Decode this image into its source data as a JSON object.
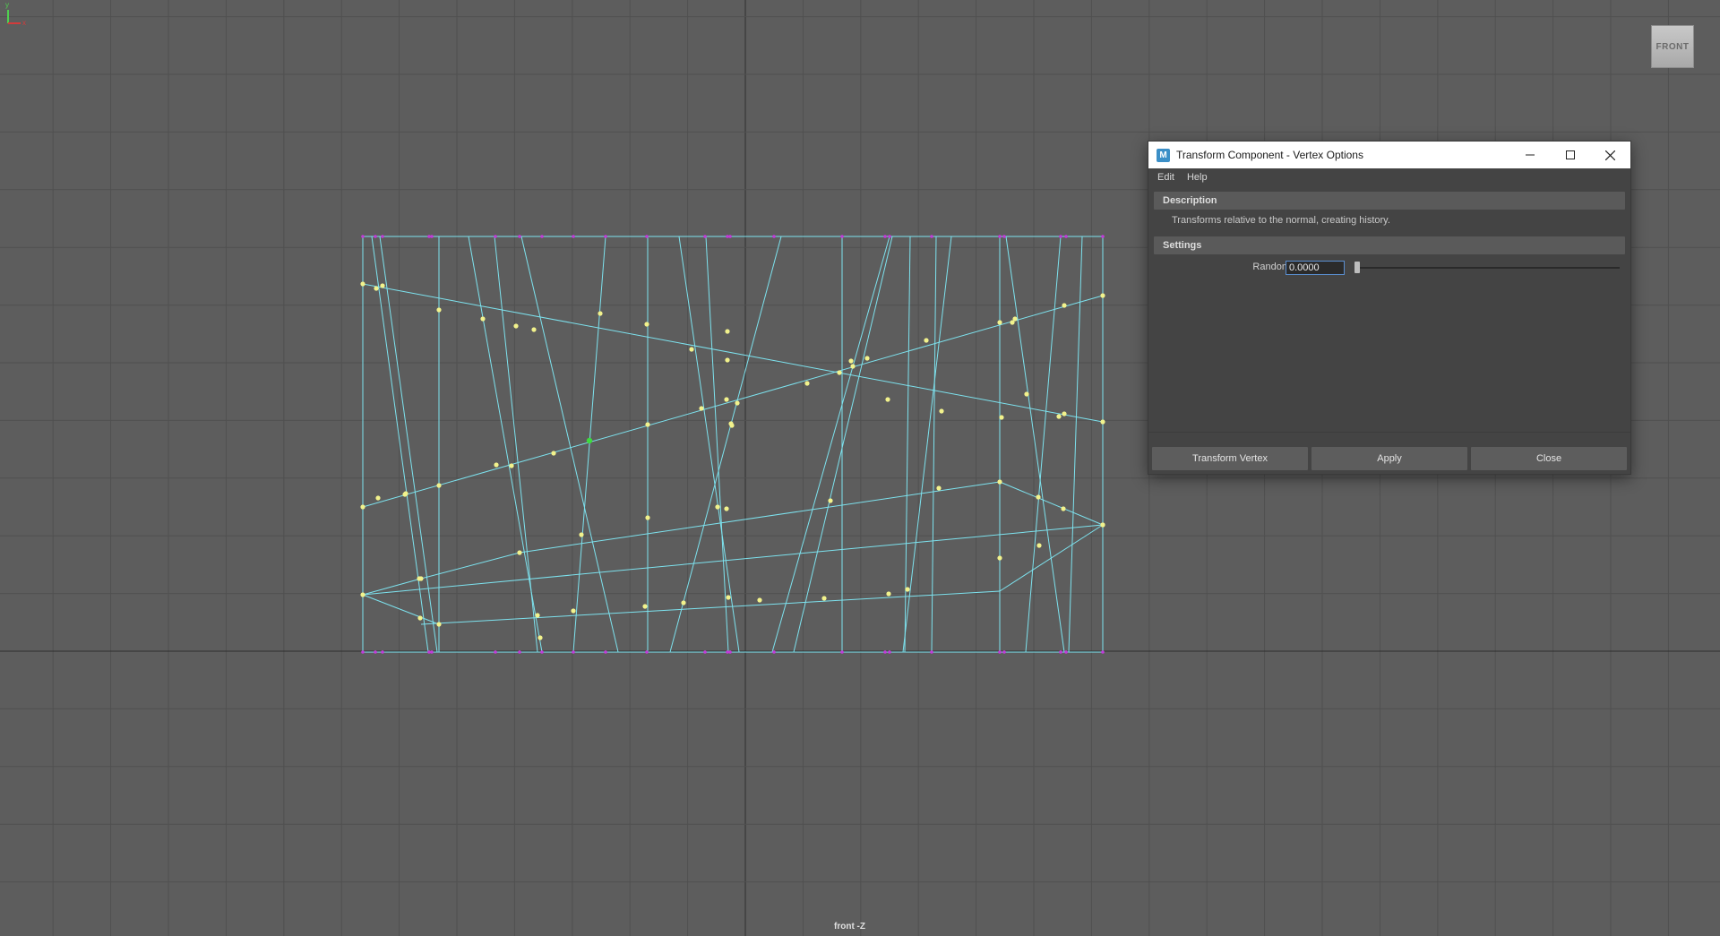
{
  "viewport": {
    "view_cube_label": "FRONT",
    "camera_label": "front -Z",
    "colors": {
      "background": "#5d5d5d",
      "grid_line": "#505050",
      "grid_axis": "#2e2e2e",
      "wireframe": "#7de2ee",
      "vertex": "#f2f28c",
      "selected_vertex": "#3ddc3d",
      "border_vertex": "#c23bd9"
    }
  },
  "dialog": {
    "title": "Transform Component - Vertex Options",
    "app_icon": "M",
    "window_buttons": [
      "minimize-icon",
      "maximize-icon",
      "close-icon"
    ],
    "menu": [
      "Edit",
      "Help"
    ],
    "description_header": "Description",
    "description_text": "Transforms relative to the normal, creating history.",
    "settings_header": "Settings",
    "random_label": "Random",
    "random_value": "0.0000",
    "random_slider_fraction": 0.0,
    "buttons": {
      "transform": "Transform Vertex",
      "apply": "Apply",
      "close": "Close"
    }
  }
}
